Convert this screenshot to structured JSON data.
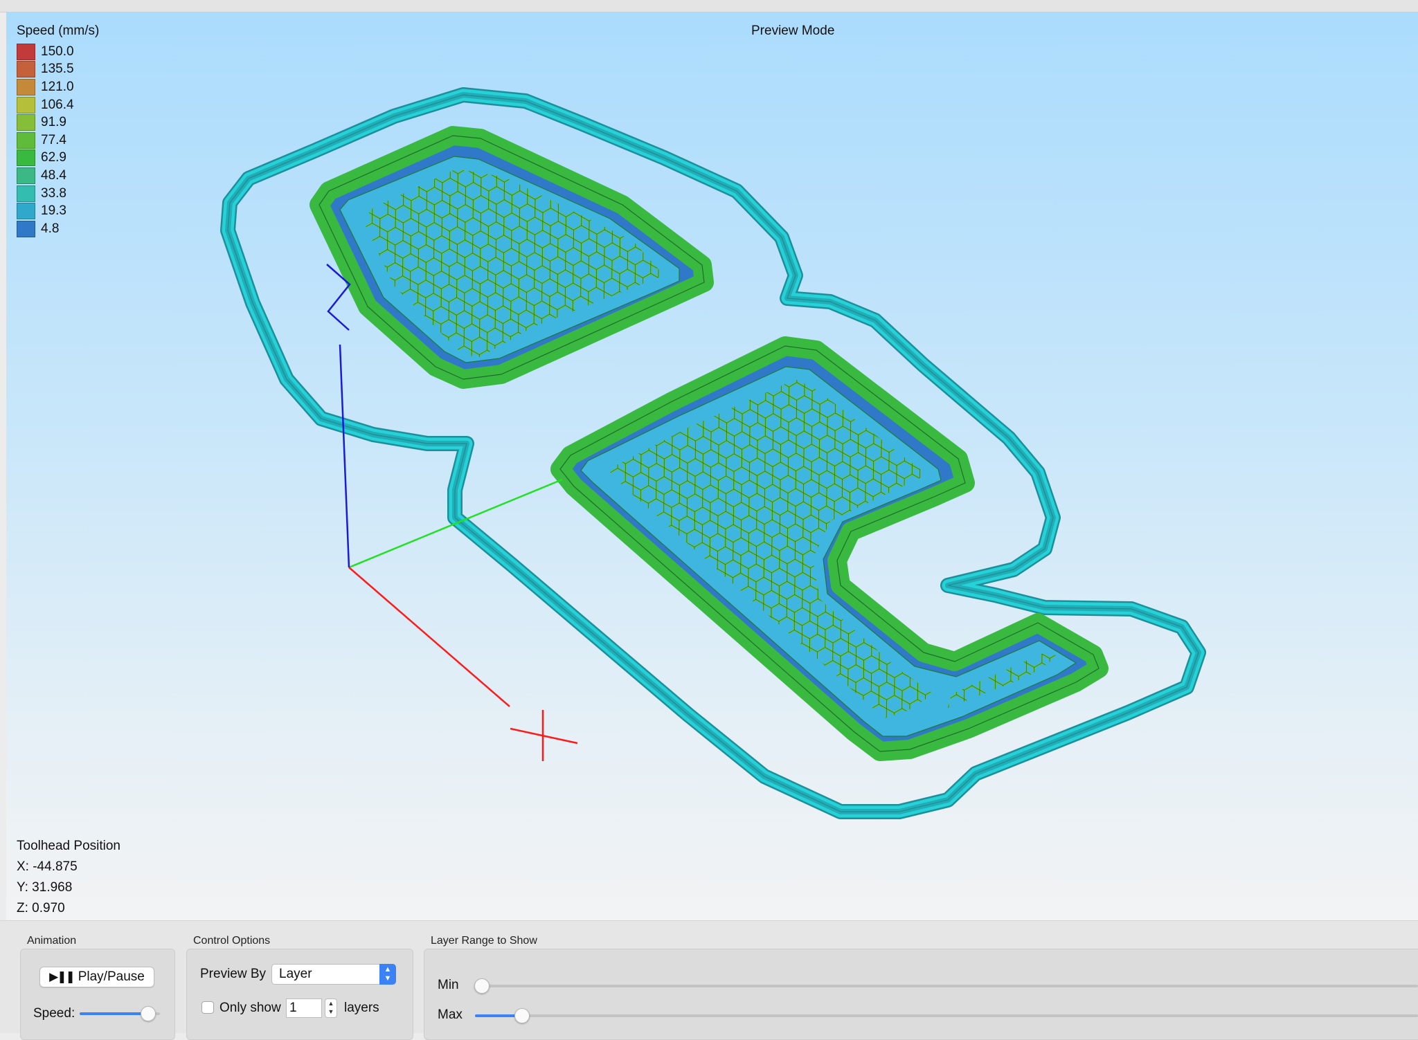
{
  "viewport": {
    "mode_label": "Preview Mode",
    "legend": {
      "title": "Speed (mm/s)",
      "items": [
        {
          "value": "150.0",
          "color": "#c23a3a"
        },
        {
          "value": "135.5",
          "color": "#c5613a"
        },
        {
          "value": "121.0",
          "color": "#c5893a"
        },
        {
          "value": "106.4",
          "color": "#b5bf3a"
        },
        {
          "value": "91.9",
          "color": "#86be3a"
        },
        {
          "value": "77.4",
          "color": "#5fbc3a"
        },
        {
          "value": "62.9",
          "color": "#3ab941"
        },
        {
          "value": "48.4",
          "color": "#3ab987"
        },
        {
          "value": "33.8",
          "color": "#33bdb0"
        },
        {
          "value": "19.3",
          "color": "#2fa8cc"
        },
        {
          "value": "4.8",
          "color": "#2f79c8"
        }
      ]
    },
    "toolhead": {
      "title": "Toolhead Position",
      "x": "X: -44.875",
      "y": "Y: 31.968",
      "z": "Z: 0.970"
    }
  },
  "animation": {
    "title": "Animation",
    "play_label": "Play/Pause",
    "speed_label": "Speed:",
    "speed_fraction": 0.85
  },
  "control_options": {
    "title": "Control Options",
    "preview_by_label": "Preview By",
    "preview_by_value": "Layer",
    "only_show_label": "Only show",
    "only_show_value": "1",
    "layers_label": "layers",
    "only_show_checked": false
  },
  "layer_range": {
    "title": "Layer Range to Show",
    "min_label": "Min",
    "max_label": "Max",
    "min_fraction": 0.0,
    "max_fraction": 0.05
  },
  "colors": {
    "skirt": "#26d2d8",
    "outer_wall": "#2f79c8",
    "inner_wall": "#3ab941",
    "infill": "#3fb6e0",
    "hex_infill": "#6bc92c",
    "axis_x": "#ff1a1a",
    "axis_y": "#22e022",
    "axis_z": "#1a1ad9"
  }
}
